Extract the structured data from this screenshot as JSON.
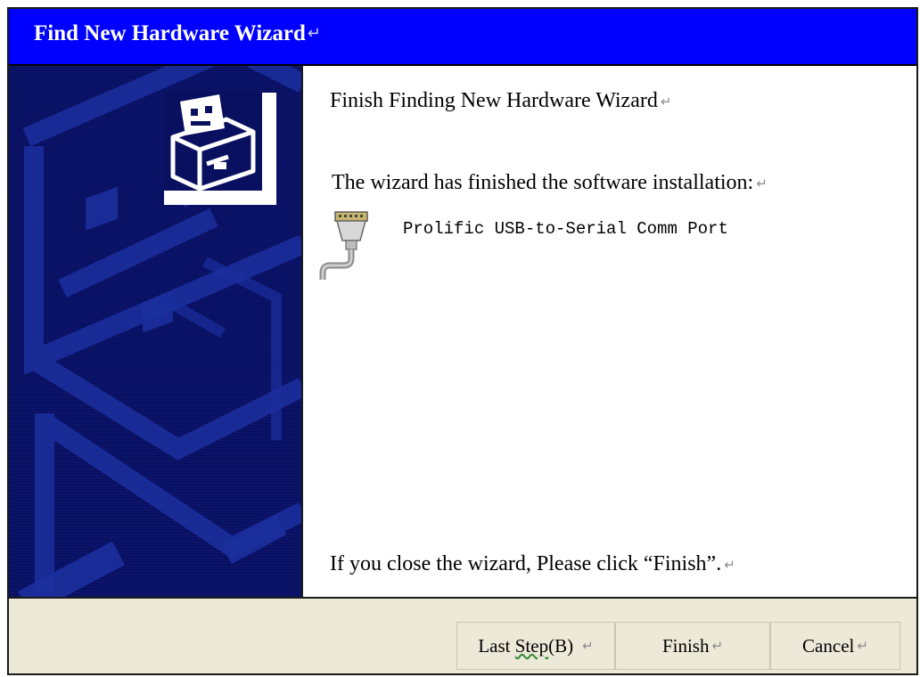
{
  "window": {
    "title": "Find New Hardware Wizard",
    "paragraph_mark": "↵"
  },
  "content": {
    "heading": "Finish Finding New Hardware Wizard",
    "message": "The wizard has finished the software installation:",
    "device": {
      "name": "Prolific USB-to-Serial Comm Port",
      "icon": "serial-port-icon"
    },
    "close_note": "If you close the wizard, Please click “Finish”."
  },
  "banner": {
    "icon": "hardware-drawer-icon"
  },
  "buttons": {
    "back_prefix": "Last ",
    "back_underlined": "Step",
    "back_suffix": "(B)",
    "finish": "Finish",
    "cancel": "Cancel"
  },
  "colors": {
    "title_bar": "#0000fe",
    "banner": "#0a1060",
    "footer": "#ece9d8"
  }
}
